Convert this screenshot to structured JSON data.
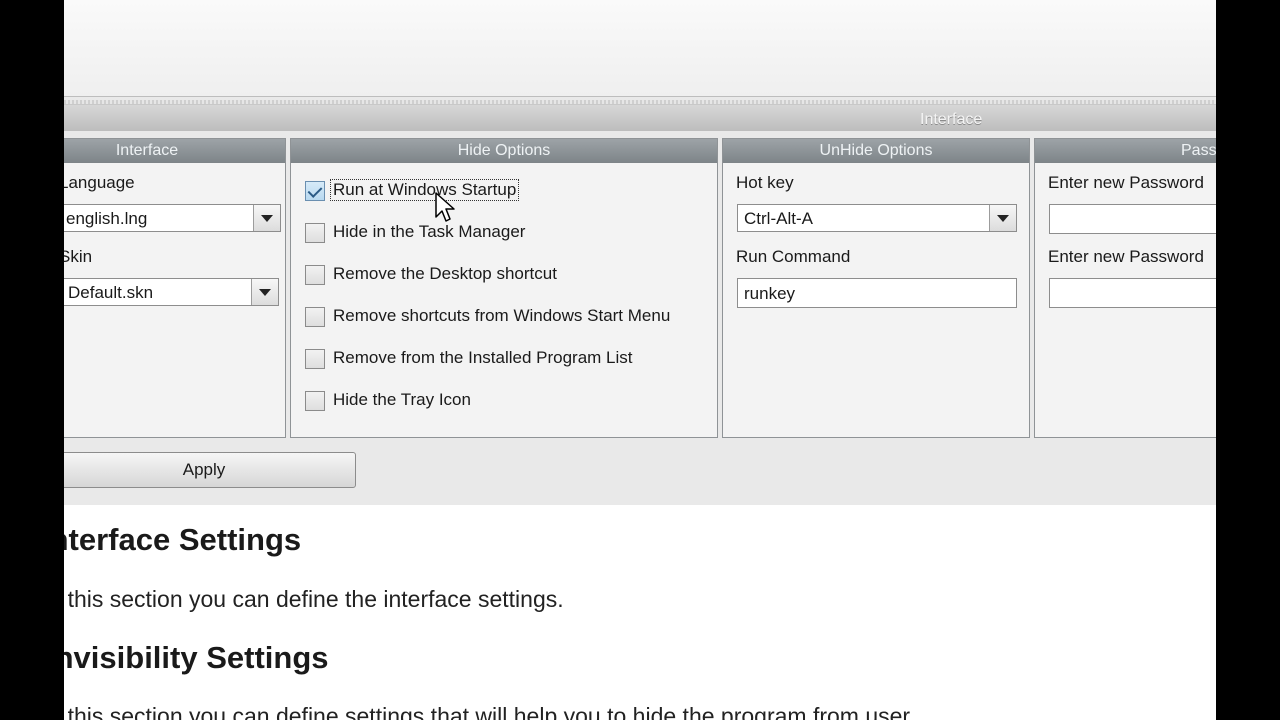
{
  "header": {
    "title": "Interface"
  },
  "panels": {
    "interface": {
      "title": "Interface",
      "language_label": "Language",
      "language_value": "english.lng",
      "skin_label": "Skin",
      "skin_value": "Default.skn"
    },
    "hide": {
      "title": "Hide Options",
      "options": [
        {
          "label": "Run at Windows Startup",
          "checked": true
        },
        {
          "label": "Hide in the Task Manager",
          "checked": false
        },
        {
          "label": "Remove the Desktop shortcut",
          "checked": false
        },
        {
          "label": "Remove shortcuts from Windows Start Menu",
          "checked": false
        },
        {
          "label": "Remove from the Installed Program List",
          "checked": false
        },
        {
          "label": "Hide the Tray Icon",
          "checked": false
        }
      ]
    },
    "unhide": {
      "title": "UnHide Options",
      "hotkey_label": "Hot key",
      "hotkey_value": "Ctrl-Alt-A",
      "run_command_label": "Run Command",
      "run_command_value": "runkey"
    },
    "password": {
      "title": "Password",
      "new_password_label": "Enter new Password",
      "confirm_password_label": "Enter new Password"
    }
  },
  "apply_label": "Apply",
  "doc": {
    "heading1": "Interface Settings",
    "para1": "In this section you can define the interface settings.",
    "heading2": "Invisibility Settings",
    "para2": "In this section you can define settings that will help you to hide the program from user."
  }
}
